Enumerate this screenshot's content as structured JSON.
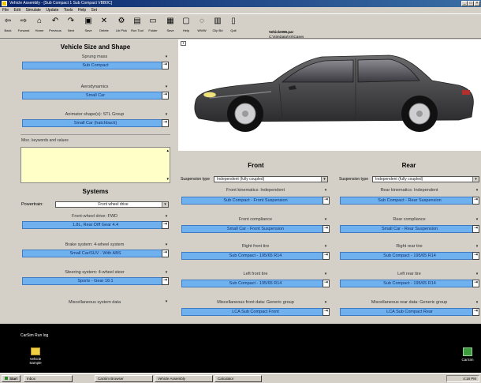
{
  "window": {
    "title": "Vehicle Assembly - [Sub Compact 1 Sub Compact VBB0C]"
  },
  "menu": [
    "File",
    "Edit",
    "Simulate",
    "Update",
    "Tools",
    "Help",
    "Set"
  ],
  "toolbar": {
    "items": [
      {
        "label": "Back",
        "icon": "back-icon",
        "glyph": "⇦"
      },
      {
        "label": "Forward",
        "icon": "forward-icon",
        "glyph": "⇨"
      },
      {
        "label": "Home",
        "icon": "home-icon",
        "glyph": "⌂"
      },
      {
        "label": "Previous",
        "icon": "previous-icon",
        "glyph": "↶"
      },
      {
        "label": "Next",
        "icon": "next-icon",
        "glyph": "↷"
      },
      {
        "label": "Save",
        "icon": "save-icon",
        "glyph": "▣"
      },
      {
        "label": "Delete",
        "icon": "delete-icon",
        "glyph": "✕"
      },
      {
        "label": "Lib Pick",
        "icon": "lib-pick-icon",
        "glyph": "⚙"
      },
      {
        "label": "Run Tool",
        "icon": "run-tool-icon",
        "glyph": "▤"
      },
      {
        "label": "Folder",
        "icon": "folder-icon",
        "glyph": "▭"
      },
      {
        "label": "Save",
        "icon": "save2-icon",
        "glyph": "▦"
      },
      {
        "label": "Help",
        "icon": "help-icon",
        "glyph": "▢"
      },
      {
        "label": "WWW",
        "icon": "www-icon",
        "glyph": "◌"
      },
      {
        "label": "Clip Bd",
        "icon": "clipboard-icon",
        "glyph": "▥"
      },
      {
        "label": "Quit",
        "icon": "quit-icon",
        "glyph": "▯"
      }
    ],
    "file_name": "Vehicle099.par",
    "file_path": "C:\\SimData\\VS\\Cases"
  },
  "vehicle": {
    "heading": "Vehicle Size and Shape",
    "sprung_mass_label": "Sprung mass",
    "sprung_mass_value": "Sub Compact",
    "aero_label": "Aerodynamics",
    "aero_value": "Small Car",
    "animator_label": "Animator shape(s): STL Group",
    "animator_value": "Small Car (hatchback)",
    "notes_label": "Misc. keywords and values",
    "notes_value": ""
  },
  "systems": {
    "heading": "Systems",
    "powertrain_label": "Powertrain:",
    "powertrain_value": "Front wheel drive",
    "drive_label": "Front-wheel drive: FWD",
    "drive_value": "1.8L, Rear Diff Gear 4.4",
    "brake_label": "Brake system: 4-wheel system",
    "brake_value": "Small Car/SUV - With ABS",
    "steer_label": "Steering system: 4-wheel steer",
    "steer_value": "Sports - Gear 16:1",
    "misc_label": "Miscellaneous system data"
  },
  "front": {
    "heading": "Front",
    "susp_type_label": "Suspension type",
    "susp_type_value": "Independent (fully coupled)",
    "kin_label": "Front kinematics: Independent",
    "kin_value": "Sub Compact - Front Suspension",
    "comp_label": "Front compliance",
    "comp_value": "Small Car - Front Suspension",
    "right_tire_label": "Right front tire",
    "right_tire_value": "Sub Compact - 195/65 R14",
    "left_tire_label": "Left front tire",
    "left_tire_value": "Sub Compact - 195/65 R14",
    "misc_label": "Miscellaneous front data: Generic group",
    "misc_value": "LCA Sub Compact Front"
  },
  "rear": {
    "heading": "Rear",
    "susp_type_label": "Suspension type",
    "susp_type_value": "Independent (fully coupled)",
    "kin_label": "Rear kinematics: Independent",
    "kin_value": "Sub Compact - Rear Suspension",
    "comp_label": "Rear compliance",
    "comp_value": "Small Car - Rear Suspension",
    "right_tire_label": "Right rear tire",
    "right_tire_value": "Sub Compact - 195/65 R14",
    "left_tire_label": "Left rear tire",
    "left_tire_value": "Sub Compact - 195/65 R14",
    "misc_label": "Miscellaneous rear data: Generic group",
    "misc_value": "LCA Sub Compact Rear"
  },
  "desktop": {
    "top_text": "CarSim Run log",
    "left_icon_label": "Vehicle Sample",
    "right_icon_label": "CarSim"
  },
  "taskbar": {
    "start": "Start",
    "tasks": [
      "Inbox",
      "CarSim Browser",
      "Vehicle Assembly",
      "Calculator"
    ],
    "clock": "4:18 PM"
  },
  "colors": {
    "select_fill": "#6fb1ee",
    "notes_fill": "#ffffc8",
    "car_body": "#4a4a4c"
  }
}
